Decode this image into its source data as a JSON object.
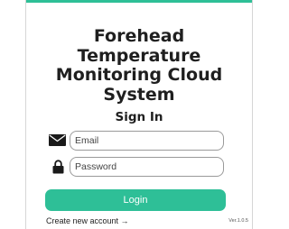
{
  "app": {
    "title": "Forehead Temperature Monitoring Cloud System",
    "accent_color": "#2ebf97"
  },
  "form": {
    "heading": "Sign In",
    "email": {
      "placeholder": "Email",
      "value": "",
      "icon": "envelope-icon"
    },
    "password": {
      "placeholder": "Password",
      "value": "",
      "icon": "lock-icon"
    },
    "login_label": "Login"
  },
  "footer": {
    "create_account": "Create new account →",
    "version": "Ver.1.0.5"
  }
}
